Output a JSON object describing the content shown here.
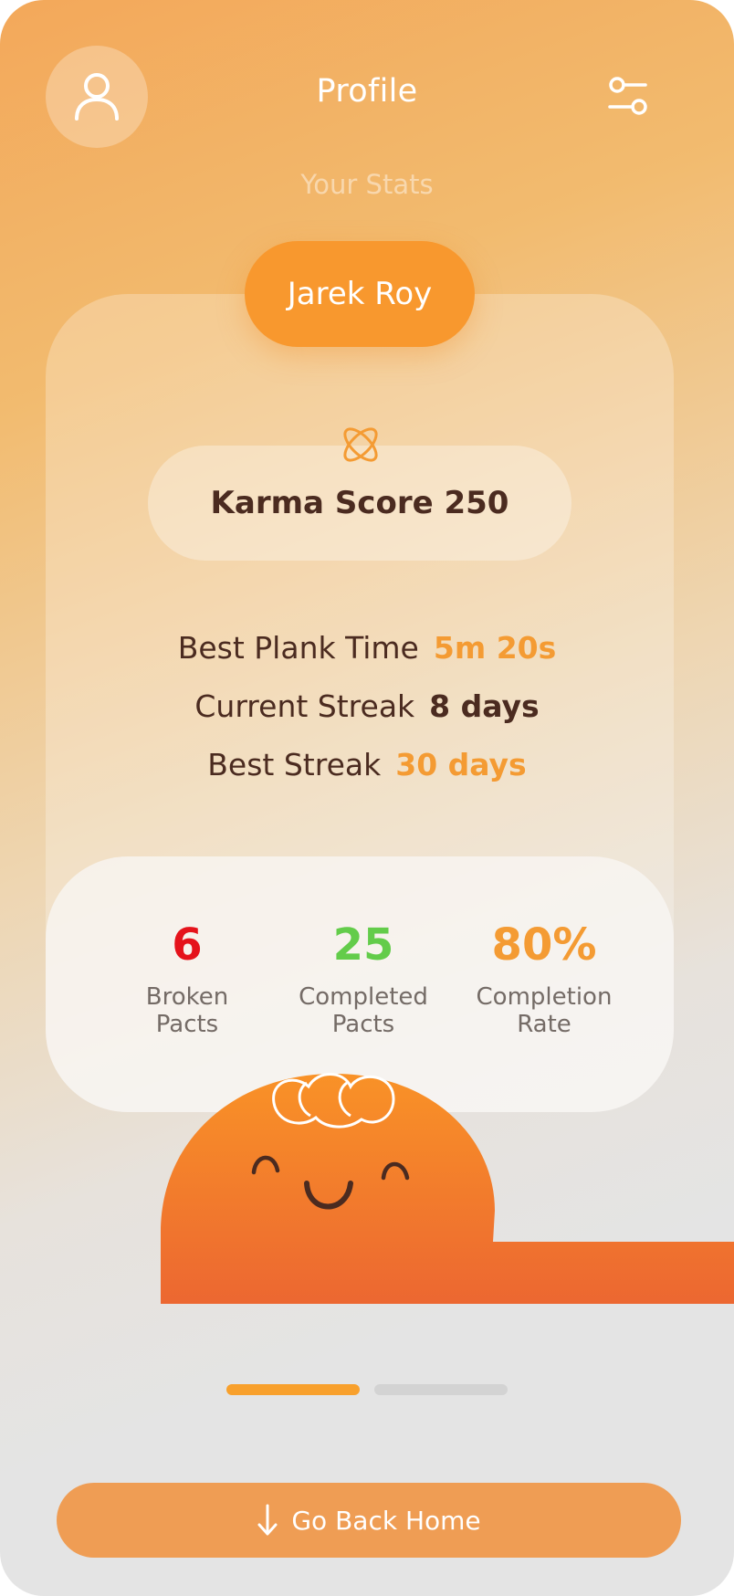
{
  "header": {
    "title": "Profile",
    "subtitle": "Your Stats",
    "avatar_icon": "user-icon",
    "settings_icon": "sliders-icon"
  },
  "profile": {
    "name": "Jarek Roy",
    "karma_label": "Karma Score 250",
    "karma_icon": "atom-icon"
  },
  "stats": [
    {
      "label": "Best Plank Time",
      "value": "5m 20s"
    },
    {
      "label": "Current Streak",
      "value": "8 days"
    },
    {
      "label": "Best Streak",
      "value": "30 days"
    }
  ],
  "metrics": [
    {
      "value": "6",
      "label_line1": "Broken",
      "label_line2": "Pacts",
      "color": "#e5131b"
    },
    {
      "value": "25",
      "label_line1": "Completed",
      "label_line2": "Pacts",
      "color": "#63cc4a"
    },
    {
      "value": "80%",
      "label_line1": "Completion",
      "label_line2": "Rate",
      "color": "#f49b33"
    }
  ],
  "pager": {
    "pages": 2,
    "active": 1
  },
  "footer": {
    "button_label": "Go Back Home",
    "button_icon": "arrow-down-icon"
  },
  "colors": {
    "accent": "#f8982e",
    "text_dark": "#4b2b20",
    "mascot": "#f2822e"
  }
}
